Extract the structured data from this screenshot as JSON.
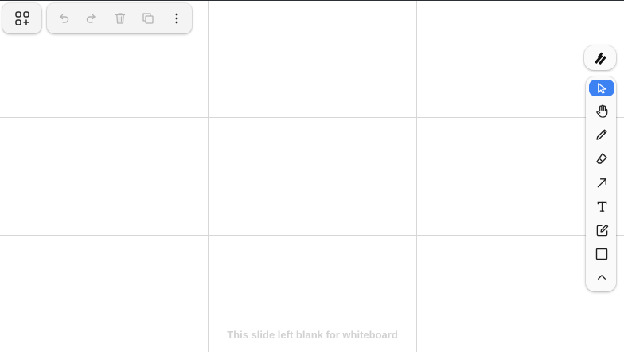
{
  "board": {
    "blank_note": "This slide left blank for whiteboard"
  },
  "top_left_toolbar": {
    "apps_icon": "apps-add-icon",
    "actions": [
      {
        "name": "undo",
        "icon": "undo-icon",
        "enabled": false
      },
      {
        "name": "redo",
        "icon": "redo-icon",
        "enabled": false
      },
      {
        "name": "delete",
        "icon": "trash-icon",
        "enabled": false
      },
      {
        "name": "duplicate",
        "icon": "duplicate-icon",
        "enabled": false
      },
      {
        "name": "more",
        "icon": "more-vertical-icon",
        "enabled": true
      }
    ]
  },
  "right_toolbar": {
    "logo_icon": "brand-logo-icon",
    "tools": [
      {
        "name": "select",
        "icon": "cursor-icon",
        "active": true
      },
      {
        "name": "hand",
        "icon": "hand-icon",
        "active": false
      },
      {
        "name": "draw",
        "icon": "pencil-icon",
        "active": false
      },
      {
        "name": "eraser",
        "icon": "eraser-icon",
        "active": false
      },
      {
        "name": "arrow",
        "icon": "arrow-icon",
        "active": false
      },
      {
        "name": "text",
        "icon": "text-icon",
        "active": false
      },
      {
        "name": "note",
        "icon": "note-icon",
        "active": false
      },
      {
        "name": "rectangle",
        "icon": "rectangle-icon",
        "active": false
      },
      {
        "name": "collapse",
        "icon": "chevron-up-icon",
        "active": false
      }
    ]
  },
  "colors": {
    "accent": "#3d82f3",
    "grid": "#d7d7d7",
    "disabled_icon": "#b4b4b4",
    "icon": "#1e1e1e",
    "note_text": "#d2d2d2"
  }
}
